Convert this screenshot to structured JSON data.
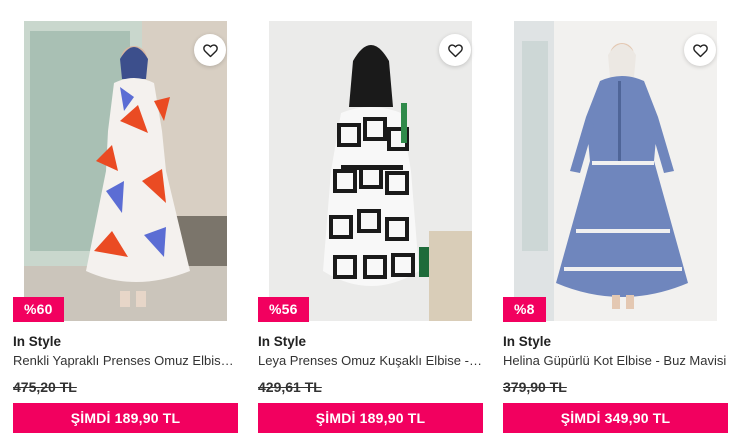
{
  "products": [
    {
      "discount": "%60",
      "brand": "In Style",
      "name": "Renkli Yapraklı Prenses Omuz Elbise - Lacivert",
      "old_price": "475,20 TL",
      "now_price": "ŞİMDİ 189,90 TL",
      "image": "woman-floral-dress-photo"
    },
    {
      "discount": "%56",
      "brand": "In Style",
      "name": "Leya Prenses Omuz Kuşaklı Elbise - Siyah",
      "old_price": "429,61 TL",
      "now_price": "ŞİMDİ 189,90 TL",
      "image": "woman-geometric-dress-photo"
    },
    {
      "discount": "%8",
      "brand": "In Style",
      "name": "Helina Güpürlü Kot Elbise - Buz Mavisi",
      "old_price": "379,90 TL",
      "now_price": "ŞİMDİ 349,90 TL",
      "image": "woman-denim-dress-photo"
    }
  ],
  "colors": {
    "accent": "#f2005f",
    "text": "#333333"
  },
  "icons": {
    "favorite": "heart-icon"
  }
}
